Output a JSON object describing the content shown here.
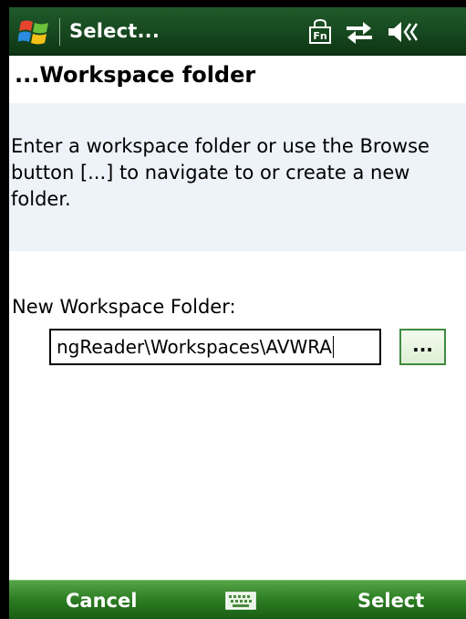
{
  "titlebar": {
    "title": "Select...",
    "icons": [
      "windows-start-icon",
      "fn-key-icon",
      "connectivity-icon",
      "speaker-icon"
    ]
  },
  "page": {
    "title": "...Workspace folder",
    "instructions": [
      "Enter a workspace folder or use the Browse",
      "button [...] to navigate to or create a new",
      "folder."
    ]
  },
  "form": {
    "field_label": "New Workspace Folder:",
    "field_value": "ngReader\\Workspaces\\AVWRA",
    "browse_label": "..."
  },
  "softkeys": {
    "left": "Cancel",
    "right": "Select",
    "center_icon": "keyboard-icon"
  },
  "colors": {
    "titlebar": "#17481f",
    "softkey_bar": "#2c7c22",
    "info_box": "#eef2f9",
    "browse_border": "#3f8a3f"
  }
}
